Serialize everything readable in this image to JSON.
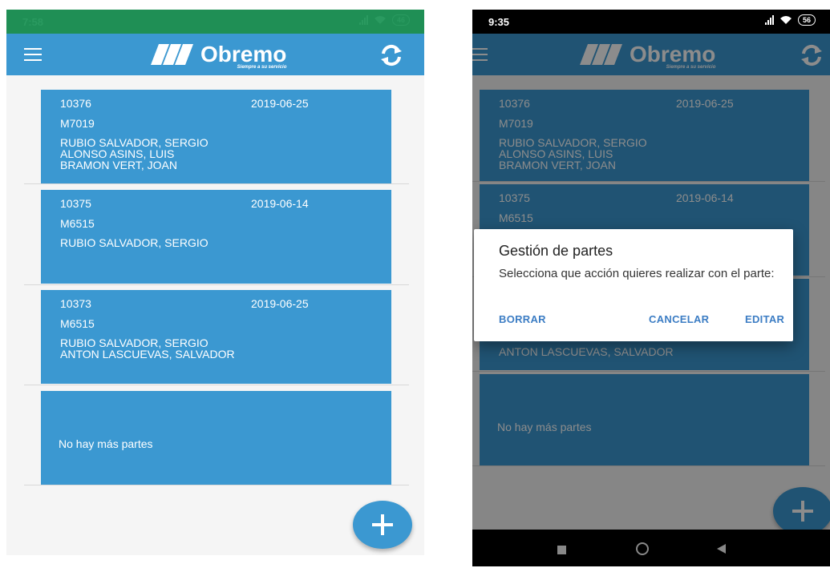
{
  "brand": {
    "name": "Obremo",
    "tagline": "Siempre a su servicio",
    "color_primary": "#3b98d1",
    "color_accent_text": "#3c7dc4"
  },
  "screens": [
    {
      "status": {
        "time": "7:58",
        "battery": "46"
      },
      "parts": [
        {
          "id": "10376",
          "date": "2019-06-25",
          "code": "M7019",
          "workers": [
            "RUBIO SALVADOR, SERGIO",
            "ALONSO ASINS, LUIS",
            "BRAMON VERT, JOAN"
          ]
        },
        {
          "id": "10375",
          "date": "2019-06-14",
          "code": "M6515",
          "workers": [
            "RUBIO SALVADOR, SERGIO"
          ]
        },
        {
          "id": "10373",
          "date": "2019-06-25",
          "code": "M6515",
          "workers": [
            "RUBIO SALVADOR, SERGIO",
            "ANTON LASCUEVAS, SALVADOR"
          ]
        }
      ],
      "empty_message": "No hay más partes",
      "fab_icon": "plus-icon"
    },
    {
      "status": {
        "time": "9:35",
        "battery": "56"
      },
      "parts": [
        {
          "id": "10376",
          "date": "2019-06-25",
          "code": "M7019",
          "workers": [
            "RUBIO SALVADOR, SERGIO",
            "ALONSO ASINS, LUIS",
            "BRAMON VERT, JOAN"
          ]
        },
        {
          "id": "10375",
          "date": "2019-06-14",
          "code": "M6515"
        }
      ],
      "partial_text": "ANTON LASCUEVAS, SALVADOR",
      "empty_message": "No hay más partes",
      "dialog": {
        "title": "Gestión de partes",
        "message": "Selecciona que acción quieres realizar con el parte:",
        "buttons": {
          "delete": "BORRAR",
          "cancel": "CANCELAR",
          "edit": "EDITAR"
        }
      },
      "navbar_icons": [
        "recent-apps-icon",
        "home-icon",
        "back-icon"
      ]
    }
  ]
}
